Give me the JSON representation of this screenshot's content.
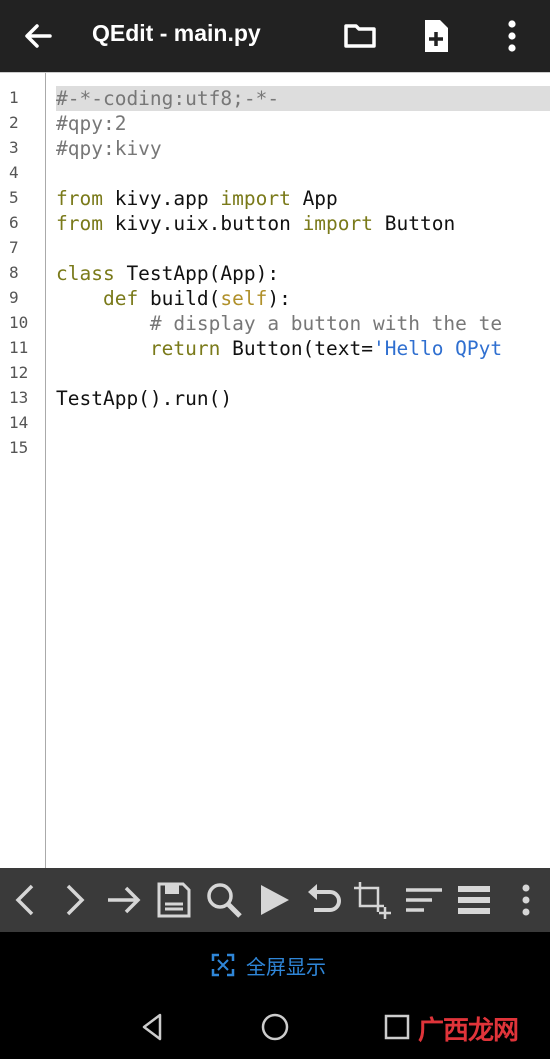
{
  "app": {
    "title": "QEdit - main.py"
  },
  "editor": {
    "line_numbers": [
      "1",
      "2",
      "3",
      "4",
      "5",
      "6",
      "7",
      "8",
      "9",
      "10",
      "11",
      "12",
      "13",
      "14",
      "15"
    ],
    "lines": [
      "#-*-coding:utf8;-*-",
      "#qpy:2",
      "#qpy:kivy",
      "",
      "from kivy.app import App",
      "from kivy.uix.button import Button",
      "",
      "class TestApp(App):",
      "    def build(self):",
      "        # display a button with the te",
      "        return Button(text='Hello QPyt",
      "",
      "TestApp().run()",
      "",
      ""
    ],
    "current_line": 1
  },
  "toolbar": {
    "icons": [
      "chevron-left-icon",
      "chevron-right-icon",
      "arrow-right-icon",
      "save-icon",
      "search-icon",
      "play-icon",
      "undo-icon",
      "crop-add-icon",
      "align-left-icon",
      "list-icon",
      "more-vert-icon"
    ]
  },
  "fullscreen": {
    "label": "全屏显示"
  },
  "watermark": {
    "text": "广西龙网"
  },
  "colors": {
    "accent": "#2f86d8",
    "keyword": "#7a7a1a",
    "string": "#2f6fd0",
    "comment": "#777777"
  }
}
